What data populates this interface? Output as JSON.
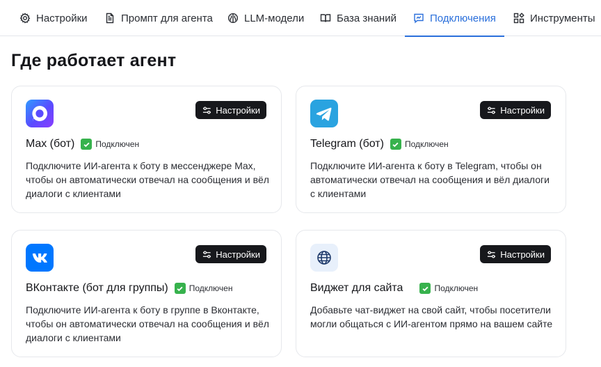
{
  "tabs": [
    {
      "label": "Настройки",
      "icon": "gear-icon"
    },
    {
      "label": "Промпт для агента",
      "icon": "document-icon"
    },
    {
      "label": "LLM-модели",
      "icon": "brain-icon"
    },
    {
      "label": "База знаний",
      "icon": "book-icon"
    },
    {
      "label": "Подключения",
      "icon": "chat-icon",
      "active": true
    },
    {
      "label": "Инструменты",
      "icon": "tools-icon"
    }
  ],
  "page_title": "Где работает агент",
  "status_connected": "Подключен",
  "settings_label": "Настройки",
  "cards": [
    {
      "name": "Max (бот)",
      "icon": "max-logo-icon",
      "status": "Подключен",
      "button": "Настройки",
      "description": "Подключите ИИ-агента к боту в мессенджере Max, чтобы он автоматически отвечал на сообщения и вёл диалоги с клиентами"
    },
    {
      "name": "Telegram (бот)",
      "icon": "telegram-logo-icon",
      "status": "Подключен",
      "button": "Настройки",
      "description": "Подключите ИИ-агента к боту в Telegram, чтобы он автоматически отвечал на сообщения и вёл диалоги с клиентами"
    },
    {
      "name": "ВКонтакте (бот для группы)",
      "icon": "vk-logo-icon",
      "status": "Подключен",
      "button": "Настройки",
      "description": "Подключите ИИ-агента к боту в группе в Вконтакте, чтобы он автоматически отвечал на сообщения и вёл диалоги с клиентами"
    },
    {
      "name": "Виджет для сайта",
      "icon": "globe-icon",
      "status": "Подключен",
      "button": "Настройки",
      "description": "Добавьте чат-виджет на свой сайт, чтобы посетители могли общаться с ИИ-агентом прямо на вашем сайте"
    }
  ],
  "colors": {
    "accent": "#2a6fdb",
    "connected_green": "#37b24d",
    "button_dark": "#17181c",
    "telegram": "#2aa3e0",
    "vk": "#0077ff",
    "widget_bg": "#e8f0fb"
  }
}
